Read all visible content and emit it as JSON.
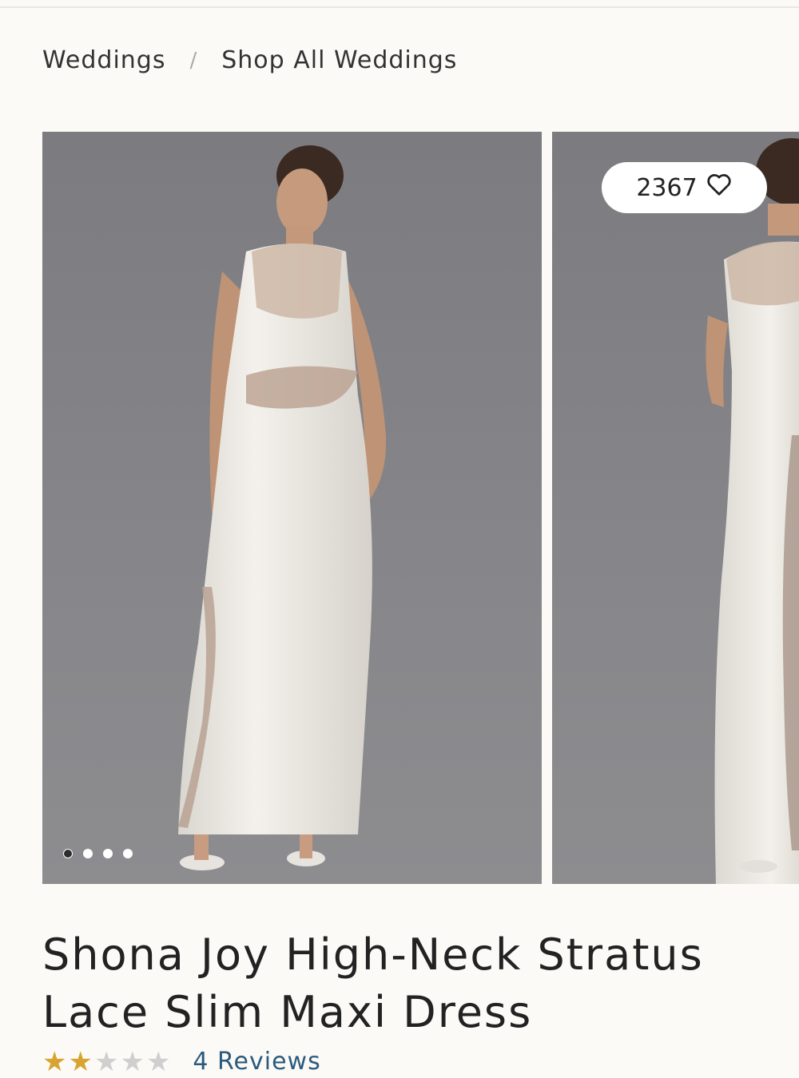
{
  "breadcrumb": {
    "items": [
      "Weddings",
      "Shop All Weddings"
    ],
    "separator": "/"
  },
  "gallery": {
    "slide_count": 4,
    "active_index": 0,
    "images": [
      "model-front-white-lace-dress",
      "model-back-white-lace-dress"
    ]
  },
  "favorites": {
    "count": "2367",
    "icon": "heart-icon"
  },
  "product": {
    "title_line1": "Shona Joy High-Neck Stratus",
    "title_line2": "Lace Slim Maxi Dress",
    "rating": 2,
    "rating_max": 5,
    "reviews_label": "4 Reviews"
  },
  "colors": {
    "background": "#fbfaf6",
    "photo_backdrop": "#808084",
    "star_filled": "#d8a431",
    "star_empty": "#cfcfcf",
    "link": "#2b5a7d"
  }
}
